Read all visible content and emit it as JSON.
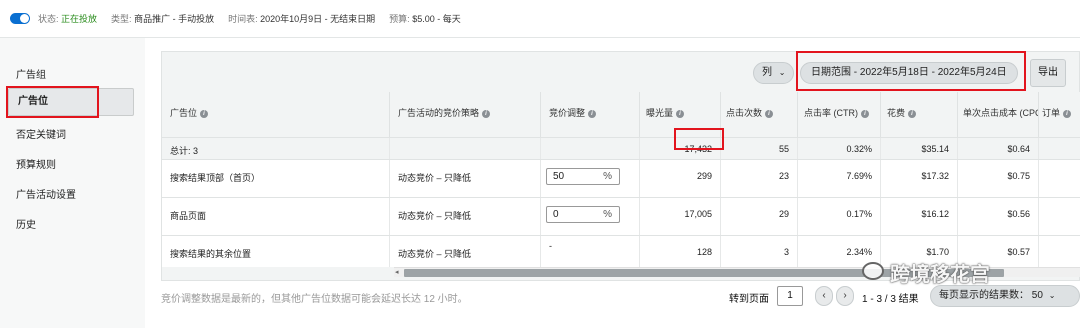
{
  "status_bar": {
    "status_key": "状态:",
    "status_value": "正在投放",
    "type_key": "类型:",
    "type_value": "商品推广 - 手动投放",
    "schedule_key": "时间表:",
    "schedule_value": "2020年10月9日 - 无结束日期",
    "budget_key": "预算:",
    "budget_value": "$5.00 - 每天"
  },
  "sidebar": {
    "items": [
      {
        "label": "广告组"
      },
      {
        "label": "广告位"
      },
      {
        "label": "否定关键词"
      },
      {
        "label": "预算规则"
      },
      {
        "label": "广告活动设置"
      },
      {
        "label": "历史"
      }
    ]
  },
  "toolbar": {
    "columns_label": "列",
    "date_range_label": "日期范围 - 2022年5月18日 - 2022年5月24日",
    "export_label": "导出"
  },
  "table": {
    "headers": [
      "广告位",
      "广告活动的竞价策略",
      "竞价调整",
      "曝光量",
      "点击次数",
      "点击率 (CTR)",
      "花费",
      "单次点击成本 (CPC)",
      "订单"
    ],
    "total": {
      "label": "总计: 3",
      "impressions": "17,432",
      "clicks": "55",
      "ctr": "0.32%",
      "spend": "$35.14",
      "cpc": "$0.64"
    },
    "rows": [
      {
        "placement": "搜索结果顶部（首页）",
        "strategy": "动态竞价 – 只降低",
        "bid_adj": "50",
        "bid_unit": "%",
        "impressions": "299",
        "clicks": "23",
        "ctr": "7.69%",
        "spend": "$17.32",
        "cpc": "$0.75"
      },
      {
        "placement": "商品页面",
        "strategy": "动态竞价 – 只降低",
        "bid_adj": "0",
        "bid_unit": "%",
        "impressions": "17,005",
        "clicks": "29",
        "ctr": "0.17%",
        "spend": "$16.12",
        "cpc": "$0.56"
      },
      {
        "placement": "搜索结果的其余位置",
        "strategy": "动态竞价 – 只降低",
        "bid_adj": "-",
        "impressions": "128",
        "clicks": "3",
        "ctr": "2.34%",
        "spend": "$1.70",
        "cpc": "$0.57"
      }
    ]
  },
  "footer": {
    "note": "竞价调整数据是最新的，但其他广告位数据可能会延迟长达 12 小时。",
    "goto_label": "转到页面",
    "page_value": "1",
    "range_label": "1 - 3 / 3 结果",
    "per_page_label": "每页显示的结果数： 50"
  },
  "watermark": "跨境移花宫",
  "colors": {
    "accent": "#0a6fd1",
    "highlight_red": "#e2141d",
    "status_green": "#2a8c1d"
  }
}
